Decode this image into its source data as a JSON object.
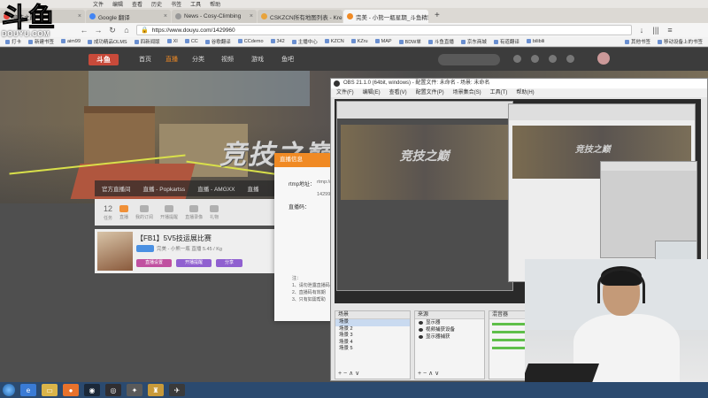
{
  "browser": {
    "menu": [
      "文件",
      "编辑",
      "查看",
      "历史",
      "书签",
      "工具",
      "帮助"
    ],
    "tabs": [
      {
        "title": "竞技之巅",
        "active": false
      },
      {
        "title": "Google 翻译",
        "active": false
      },
      {
        "title": "News - Cosy-Climbing",
        "active": false
      },
      {
        "title": "CSKZCN所有地图列表 - Kre...",
        "active": false
      },
      {
        "title": "完美 - 小熊一瓶星期_斗鱼精彩...",
        "active": true
      }
    ],
    "url": "https://www.douyu.com/1429960",
    "bookmarks": [
      "打卡",
      "新建书签",
      "aim99",
      "成功精品OLMS",
      "四新闻版",
      "XI",
      "CC",
      "谷歌翻译",
      "CCdemo",
      "342",
      "主播中心",
      "KZCN",
      "KZru",
      "MAP",
      "BDW单",
      "斗鱼直播",
      "京东商城",
      "有道翻译",
      "bilibili"
    ],
    "bookmarks_right": [
      "其他书签",
      "移动设备上的书签"
    ]
  },
  "overlay": {
    "logo": "斗鱼",
    "site": "DOUYU.COM"
  },
  "site": {
    "nav": [
      "首页",
      "直播",
      "分类",
      "视频",
      "游戏",
      "鱼吧"
    ],
    "banner_title": "竞技之巅",
    "section_tabs": [
      "官方直播间",
      "直播 - Popkartss",
      "直播 - AMGXX",
      "直播"
    ],
    "stats": [
      {
        "value": "12",
        "label": "任务"
      },
      {
        "value": "",
        "label": "直播"
      },
      {
        "value": "",
        "label": "我的订阅"
      },
      {
        "value": "",
        "label": "开播提醒"
      },
      {
        "value": "",
        "label": "直播录像"
      },
      {
        "value": "",
        "label": "礼物"
      }
    ],
    "room": {
      "title": "【FB1】5V5技运展比赛",
      "meta": "完美 - 小熊一瓶  直播  5.45 / Kg",
      "btn1": "直播设置",
      "btn2": "开播提醒",
      "btn3": "分享"
    },
    "rtmp": {
      "header": "直播信息",
      "addr_label": "rtmp地址：",
      "addr_value": "rtmp://",
      "code_label": "直播码：",
      "code_value": "14299",
      "notes": "注：\n1、请勿泄露直播码\n2、直播码有效期\n3、只有如需帮助"
    }
  },
  "obs": {
    "title": "OBS 21.1.0 (64bit, windows) - 配置文件: 未命名 - 场景: 未命名",
    "menu": [
      "文件(F)",
      "编辑(E)",
      "查看(V)",
      "配置文件(P)",
      "场景集合(S)",
      "工具(T)",
      "帮助(H)"
    ],
    "preview_banner": "竞技之巅",
    "scenes_head": "场景",
    "scenes": [
      "场景",
      "场景 2",
      "场景 3",
      "场景 4",
      "场景 5"
    ],
    "sources_head": "来源",
    "sources": [
      "显示器",
      "视频捕获设备",
      "显示器捕获"
    ],
    "mixer_head": "混音器",
    "dock_controls": "+ − ∧ ∨"
  },
  "taskbar": {
    "icons": [
      "start",
      "ie",
      "folder",
      "firefox",
      "steam",
      "obs",
      "game1",
      "game2",
      "cs"
    ]
  }
}
